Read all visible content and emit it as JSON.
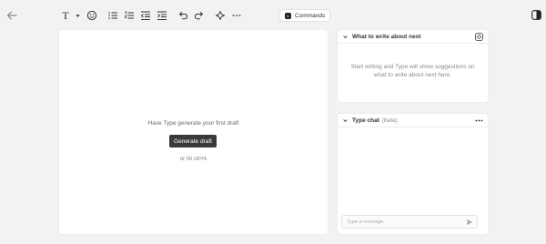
{
  "toolbar": {
    "text_style_label": "T",
    "items": [
      "text-style",
      "sticker",
      "bullet-list",
      "numbered-list",
      "outdent",
      "indent",
      "undo",
      "redo",
      "ai-sparkle",
      "more"
    ]
  },
  "commands": {
    "kbd": "k",
    "label": "Commands"
  },
  "editor": {
    "prompt": "Have Type generate your first draft",
    "generate_button": "Generate draft",
    "hint": "or hit ctrl+k"
  },
  "write_panel": {
    "title": "What to write about next",
    "empty_text": "Start writing and Type will show suggestions on what to write about next here."
  },
  "chat_panel": {
    "title": "Type chat",
    "badge": "(beta)",
    "placeholder": "Type a message"
  },
  "colors": {
    "background": "#f2f2f2",
    "card": "#ffffff",
    "primary_button": "#3a3a3a"
  }
}
